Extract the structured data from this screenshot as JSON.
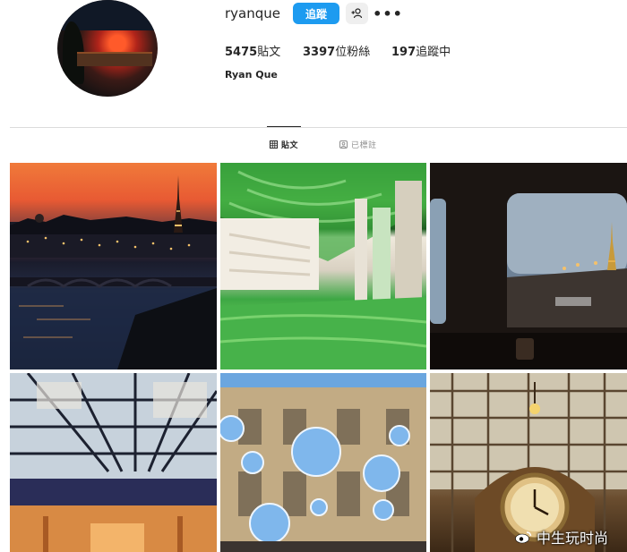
{
  "profile": {
    "username": "ryanque",
    "follow_label": "追蹤",
    "full_name": "Ryan Que",
    "stats": {
      "posts_count": "5475",
      "posts_label": "貼文",
      "followers_count": "3397",
      "followers_label": "位粉絲",
      "following_count": "197",
      "following_label": "追蹤中"
    }
  },
  "tabs": [
    {
      "label": "貼文",
      "icon": "grid-icon",
      "active": true
    },
    {
      "label": "已標註",
      "icon": "tagged-icon",
      "active": false
    }
  ],
  "grid": [
    {
      "subject": "paris-sunset-eiffel"
    },
    {
      "subject": "green-ceiling-gallery"
    },
    {
      "subject": "train-window-eiffel"
    },
    {
      "subject": "glass-roof-atrium"
    },
    {
      "subject": "mirror-spheres-facade"
    },
    {
      "subject": "orsay-clock"
    }
  ],
  "watermark": {
    "text": "中生玩时尚"
  },
  "colors": {
    "accent": "#1d9bf0",
    "divider": "#dbdbdb"
  }
}
